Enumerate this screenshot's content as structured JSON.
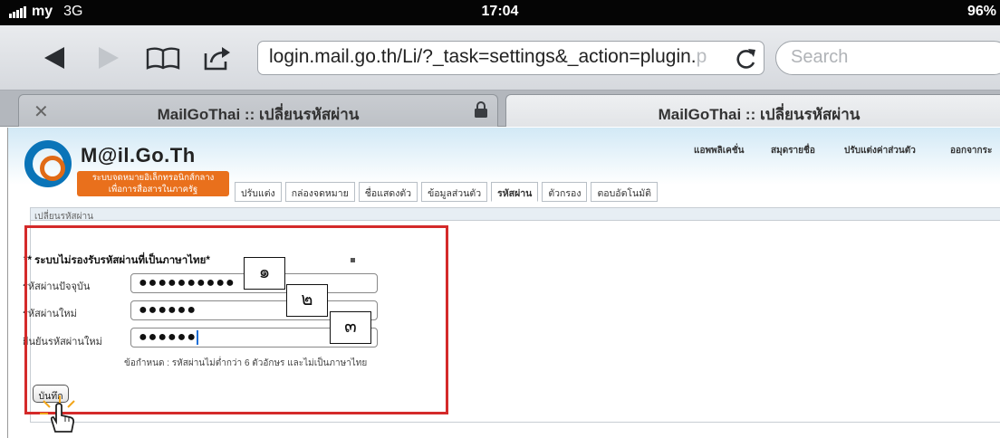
{
  "status_bar": {
    "carrier": "my",
    "network": "3G",
    "time": "17:04",
    "battery": "96%"
  },
  "browser": {
    "url": "login.mail.go.th/Li/?_task=settings&_action=plugin.",
    "url_overflow": "p",
    "search_placeholder": "Search",
    "tabs": [
      {
        "title": "MailGoThai :: เปลี่ยนรหัสผ่าน"
      },
      {
        "title": "MailGoThai :: เปลี่ยนรหัสผ่าน"
      }
    ]
  },
  "site": {
    "logo_name": "M@il.Go.Th",
    "logo_sub_line1": "ระบบจดหมายอิเล็กทรอนิกส์กลาง",
    "logo_sub_line2": "เพื่อการสื่อสารในภาครัฐ",
    "top_nav": [
      "แอพพลิเคชั่น",
      "สมุดรายชื่อ",
      "ปรับแต่งค่าส่วนตัว",
      "ออกจากระ"
    ],
    "settings_tabs": [
      "ปรับแต่ง",
      "กล่องจดหมาย",
      "ชื่อแสดงตัว",
      "ข้อมูลส่วนตัว",
      "รหัสผ่าน",
      "ตัวกรอง",
      "ตอบอัตโนมัติ"
    ],
    "active_tab_index": 4
  },
  "form": {
    "panel_title": "เปลี่ยนรหัสผ่าน",
    "notice": "** ระบบไม่รองรับรหัสผ่านที่เป็นภาษาไทย*",
    "fields": [
      {
        "label": "รหัสผ่านปัจจุบัน",
        "value": "●●●●●●●●●●"
      },
      {
        "label": "รหัสผ่านใหม่",
        "value": "●●●●●●"
      },
      {
        "label": "ยืนยันรหัสผ่านใหม่",
        "value": "●●●●●●"
      }
    ],
    "hint": "ข้อกำหนด : รหัสผ่านไม่ต่ำกว่า 6 ตัวอักษร และไม่เป็นภาษาไทย",
    "save_label": "บันทึก"
  },
  "callouts": [
    "๑",
    "๒",
    "๓"
  ],
  "colors": {
    "highlight_box": "#d42a2a",
    "logo_orange": "#e9701c",
    "logo_blue": "#0a74b8"
  }
}
